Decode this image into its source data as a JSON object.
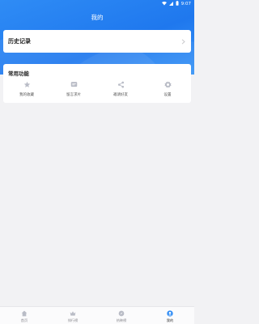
{
  "status_bar": {
    "time": "9:07"
  },
  "header": {
    "title": "我的"
  },
  "history": {
    "label": "历史记录"
  },
  "features": {
    "title": "常用功能",
    "items": [
      {
        "label": "我的收藏",
        "icon": "star-icon"
      },
      {
        "label": "留言求片",
        "icon": "message-icon"
      },
      {
        "label": "邀请好友",
        "icon": "share-icon"
      },
      {
        "label": "设置",
        "icon": "gear-icon"
      }
    ]
  },
  "tabbar": {
    "items": [
      {
        "label": "首页",
        "icon": "home-icon",
        "active": false
      },
      {
        "label": "排行榜",
        "icon": "crown-icon",
        "active": false
      },
      {
        "label": "热映榜",
        "icon": "compass-icon",
        "active": false
      },
      {
        "label": "我的",
        "icon": "profile-icon",
        "active": true
      }
    ]
  },
  "colors": {
    "primary": "#1f78ee",
    "accent": "#2f8cf5",
    "icon_gray": "#b9bcc6"
  }
}
